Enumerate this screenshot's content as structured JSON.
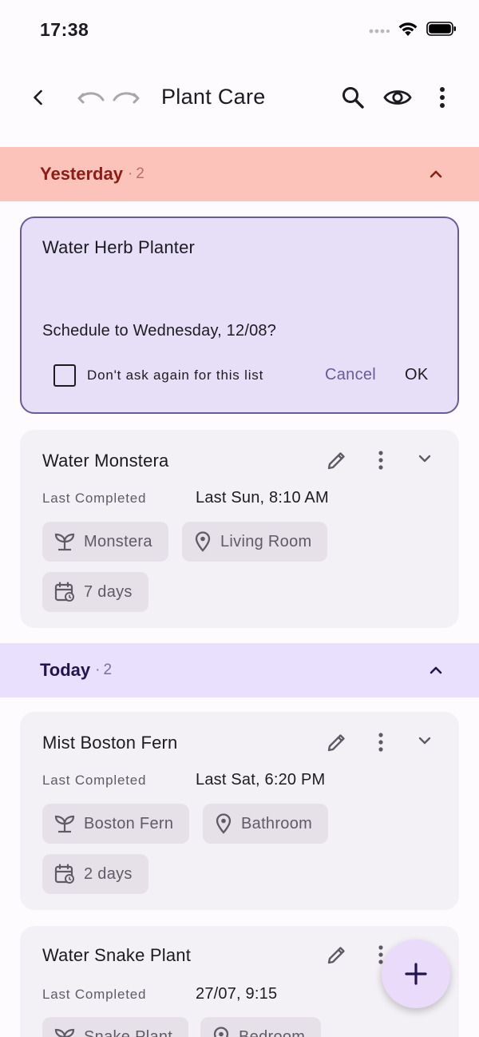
{
  "status_bar": {
    "time": "17:38"
  },
  "app_bar": {
    "title": "Plant Care"
  },
  "colors": {
    "yesterday_bg": "#fcc3bb",
    "yesterday_text": "#8a1e16",
    "today_bg": "#e8e0fc",
    "today_text": "#23144f",
    "accent": "#6a5a98"
  },
  "sections": {
    "yesterday": {
      "title": "Yesterday",
      "separator": "·",
      "count": "2"
    },
    "today": {
      "title": "Today",
      "separator": "·",
      "count": "2"
    }
  },
  "prompt": {
    "title": "Water Herb Planter",
    "question": "Schedule to Wednesday, 12/08?",
    "checkbox_label": "Don't ask again for this list",
    "cancel_label": "Cancel",
    "ok_label": "OK"
  },
  "tasks": [
    {
      "title": "Water Monstera",
      "last_completed_label": "Last Completed",
      "last_completed_value": "Last Sun, 8:10 AM",
      "plant": "Monstera",
      "location": "Living Room",
      "interval": "7 days"
    },
    {
      "title": "Mist Boston Fern",
      "last_completed_label": "Last Completed",
      "last_completed_value": "Last Sat, 6:20 PM",
      "plant": "Boston Fern",
      "location": "Bathroom",
      "interval": "2 days"
    },
    {
      "title": "Water Snake Plant",
      "last_completed_label": "Last Completed",
      "last_completed_value": "27/07, 9:15",
      "plant": "Snake Plant",
      "location": "Bedroom"
    }
  ]
}
